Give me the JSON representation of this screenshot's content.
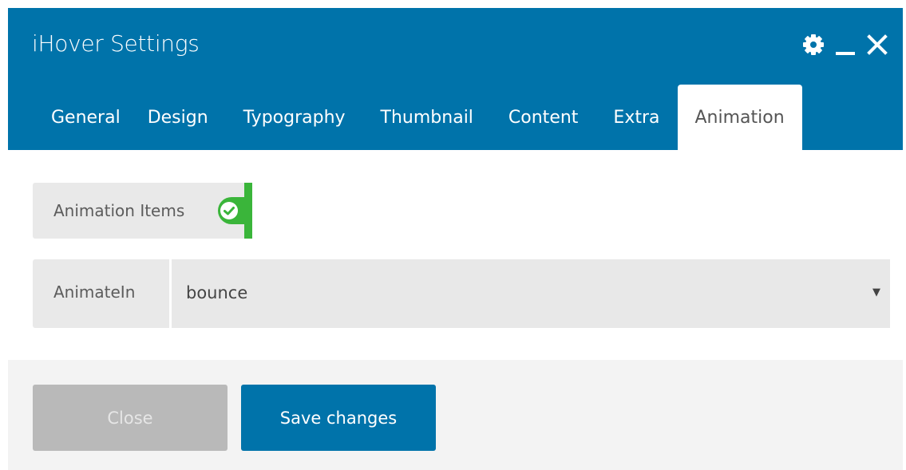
{
  "window": {
    "title": "iHover Settings",
    "controls": [
      {
        "name": "settings",
        "icon": "gear-icon"
      },
      {
        "name": "minimize",
        "icon": "minimize-icon"
      },
      {
        "name": "close",
        "icon": "close-icon"
      }
    ]
  },
  "tabs": [
    {
      "label": "General",
      "active": false
    },
    {
      "label": "Design",
      "active": false
    },
    {
      "label": "Typography",
      "active": false
    },
    {
      "label": "Thumbnail",
      "active": false
    },
    {
      "label": "Content",
      "active": false
    },
    {
      "label": "Extra",
      "active": false
    },
    {
      "label": "Animation",
      "active": true
    }
  ],
  "animation_items": {
    "label": "Animation Items",
    "enabled": true,
    "icon": "check-icon"
  },
  "animate_in": {
    "label": "AnimateIn",
    "value": "bounce",
    "arrow": "▼"
  },
  "footer": {
    "close_label": "Close",
    "save_label": "Save changes"
  },
  "colors": {
    "primary": "#0073aa",
    "toggle_on": "#3ab53a",
    "close_button": "#b9b9b9"
  }
}
